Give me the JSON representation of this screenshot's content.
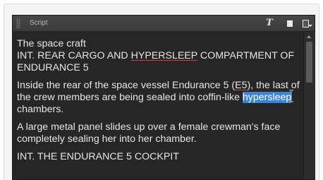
{
  "panel": {
    "title": "Script"
  },
  "toolbar": {
    "font_icon_glyph": "T",
    "icons": [
      "font-icon",
      "window-icon",
      "panel-menu-icon"
    ]
  },
  "script": {
    "scene_heading_1": "The space craft",
    "heading_line_pre": "INT. REAR CARGO AND ",
    "heading_line_link": "HYPERSLEEP",
    "heading_line_post": " COMPARTMENT OF ENDURANCE 5",
    "para2_pre": "Inside the rear of the space vessel Endurance 5 (",
    "para2_link": "E5",
    "para2_mid": "), the last of the crew members are being sealed into coffin-like ",
    "para2_selected": "hypersleep",
    "para2_post": " chambers.",
    "para3": "A large metal panel slides up over a female crewman's face completely sealing her into her chamber.",
    "para4": "INT. THE ENDURANCE 5 COCKPIT"
  },
  "colors": {
    "panel_bg": "#303030",
    "content_bg": "#262626",
    "text": "#e6e6e6",
    "selection": "#3a86d4",
    "spell_underline": "#d93a3a"
  }
}
